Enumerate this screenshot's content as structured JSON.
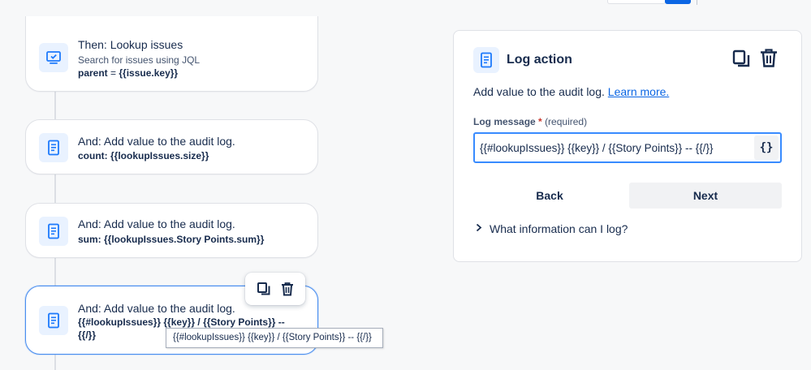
{
  "rule_cards": [
    {
      "title": "Then: Lookup issues",
      "subtitle": "Search for issues using JQL",
      "detail_key": "parent",
      "detail_op": " = ",
      "detail_value": "{{issue.key}}"
    },
    {
      "title": "And: Add value to the audit log.",
      "detail": "count: {{lookupIssues.size}}"
    },
    {
      "title": "And: Add value to the audit log.",
      "detail": "sum: {{lookupIssues.Story Points.sum}}"
    },
    {
      "title": "And: Add value to the audit log.",
      "detail_line1": "{{#lookupIssues}} {{key}} / {{Story Points}} --",
      "detail_line2": "{{/}}"
    }
  ],
  "tooltip": "{{#lookupIssues}} {{key}} / {{Story Points}} -- {{/}}",
  "icons": {
    "card_icon": "document-icon",
    "first_card_icon": "monitor-check-icon",
    "copy": "copy-icon",
    "delete": "trash-icon",
    "chevron": "chevron-right-icon"
  },
  "panel": {
    "title": "Log action",
    "description": "Add value to the audit log.",
    "learn_more": "Learn more.",
    "field_label": "Log message",
    "required_mark": "*",
    "required_text": "(required)",
    "field_value": "{{#lookupIssues}} {{key}} / {{Story Points}} -- {{/}}",
    "smart_value_button": "{}",
    "back_label": "Back",
    "next_label": "Next",
    "disclosure_label": "What information can I log?"
  },
  "colors": {
    "accent": "#0c66e4",
    "focus_border": "#388bff",
    "selected_card_border": "#4b8ff0",
    "icon_bg": "#e9f2ff"
  }
}
